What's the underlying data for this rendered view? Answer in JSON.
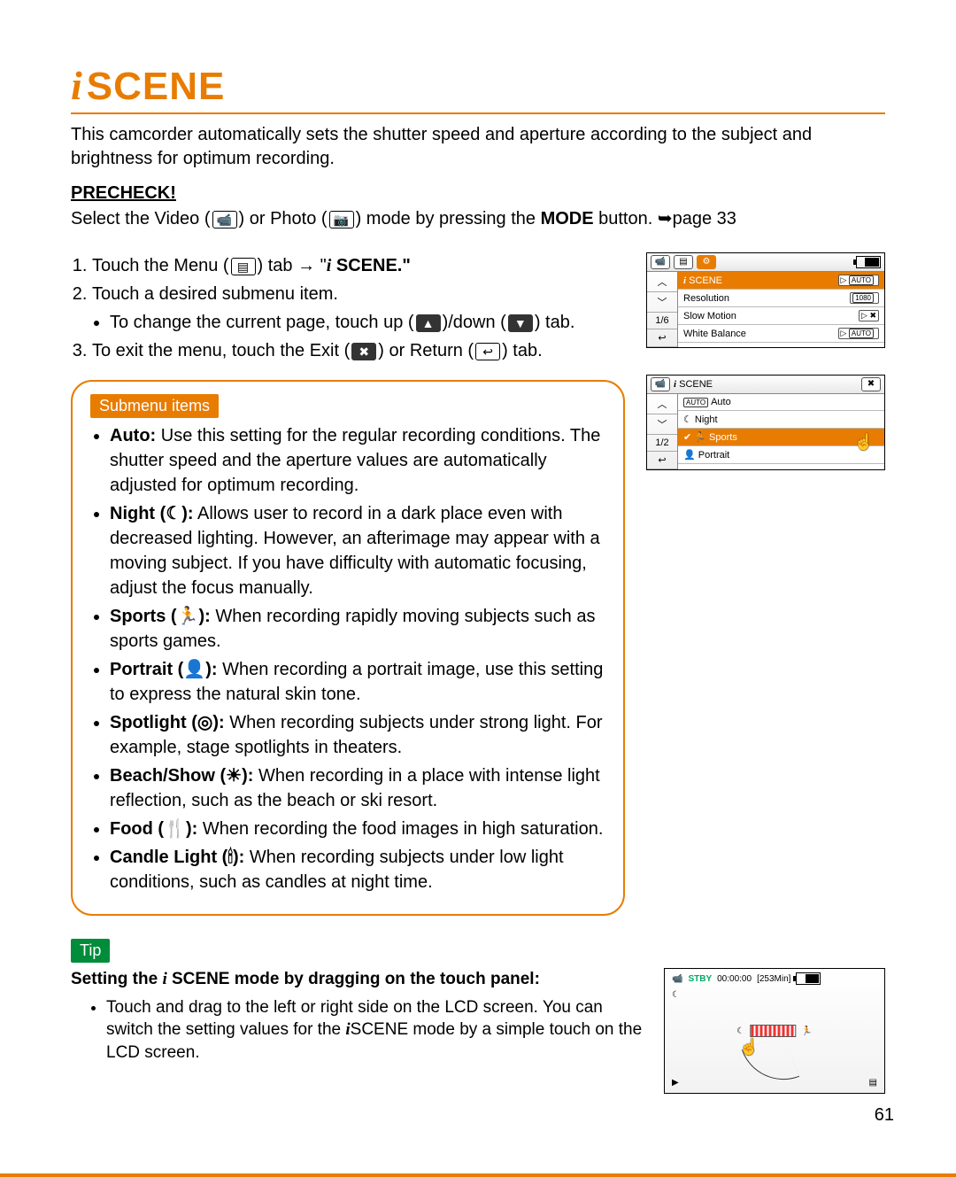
{
  "title": "SCENE",
  "intro": "This camcorder automatically sets the shutter speed and aperture according to the subject and brightness for optimum recording.",
  "precheck_h": "PRECHECK!",
  "precheck": {
    "a": "Select the Video (",
    "b": ") or Photo (",
    "c": ") mode by pressing the ",
    "d": "MODE",
    "e": " button. ",
    "f": "page 33"
  },
  "steps": {
    "s1a": "Touch the Menu (",
    "s1b": ") tab → ",
    "s1c": " SCENE.\"",
    "s2": "Touch a desired submenu item.",
    "s2sub_a": "To change the current page, touch up (",
    "s2sub_b": ")/down (",
    "s2sub_c": ") tab.",
    "s3a": "To exit the menu, touch the Exit (",
    "s3b": ") or Return (",
    "s3c": ") tab."
  },
  "submenu_heading": "Submenu items",
  "submenu": {
    "auto_b": "Auto:",
    "auto_t": " Use this setting for the regular recording conditions. The shutter speed and the aperture values are automatically adjusted for optimum recording.",
    "night_b": "Night (",
    "night_b2": "):",
    "night_t": " Allows user to record in a dark place even with decreased lighting. However, an afterimage may appear with a moving subject. If you have difficulty with automatic focusing, adjust the focus manually.",
    "sports_b": "Sports (",
    "sports_b2": "):",
    "sports_t": " When recording rapidly moving subjects such as sports games.",
    "portrait_b": "Portrait (",
    "portrait_b2": "):",
    "portrait_t": " When recording a portrait image, use this setting to express the natural skin tone.",
    "spotlight_b": "Spotlight (",
    "spotlight_b2": "):",
    "spotlight_t": " When recording subjects under strong light. For example, stage spotlights in theaters.",
    "beach_b": "Beach/Show (",
    "beach_b2": "):",
    "beach_t": " When recording in a place with intense light reflection, such as the beach or ski resort.",
    "food_b": "Food (",
    "food_b2": "):",
    "food_t": " When recording the food images in high saturation.",
    "candle_b": "Candle Light (",
    "candle_b2": "):",
    "candle_t": " When recording subjects under low light conditions, such as candles at night time."
  },
  "tip_label": "Tip",
  "tip_heading_a": "Setting the ",
  "tip_heading_b": " SCENE mode by dragging on the touch panel:",
  "tip_body_a": "Touch and drag to the left or right side on the LCD screen. You can switch the setting values for the ",
  "tip_body_b": "SCENE mode by a simple touch on the LCD screen.",
  "page_number": "61",
  "screen1": {
    "page": "1/6",
    "row1": "SCENE",
    "row2": "Resolution",
    "row3": "Slow Motion",
    "row4": "White Balance",
    "badge_auto": "AUTO",
    "badge_1080": "1080"
  },
  "screen2": {
    "title": "SCENE",
    "page": "1/2",
    "row1": "Auto",
    "row2": "Night",
    "row3": "Sports",
    "row4": "Portrait",
    "badge_auto": "AUTO"
  },
  "screen3": {
    "stby": "STBY",
    "time": "00:00:00",
    "remain": "[253Min]"
  }
}
